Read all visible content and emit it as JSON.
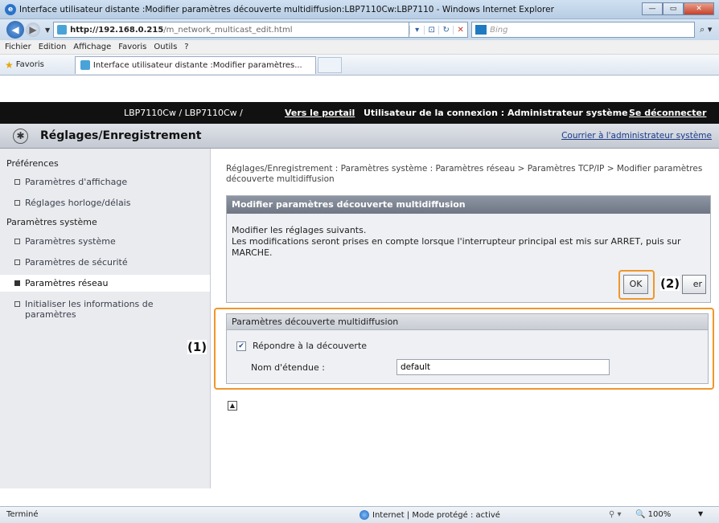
{
  "window": {
    "title": "Interface utilisateur distante :Modifier paramètres découverte multidiffusion:LBP7110Cw:LBP7110 - Windows Internet Explorer",
    "minimize": "—",
    "maximize": "▭",
    "close": "✕"
  },
  "address": {
    "url_host": "http://192.168.0.215",
    "url_path": "/m_network_multicast_edit.html",
    "search_placeholder": "Bing"
  },
  "menu": [
    "Fichier",
    "Edition",
    "Affichage",
    "Favoris",
    "Outils",
    "?"
  ],
  "favorites": {
    "label": "Favoris",
    "tab_title": "Interface utilisateur distante :Modifier paramètres..."
  },
  "topbar": {
    "model": "LBP7110Cw / LBP7110Cw /",
    "portal_link": "Vers le portail",
    "user_label": "Utilisateur de la connexion : Administrateur système",
    "logout": "Se déconnecter"
  },
  "category": {
    "title": "Réglages/Enregistrement",
    "mail_link": "Courrier à l'administrateur système"
  },
  "sidebar": {
    "section1": "Préférences",
    "items1": [
      "Paramètres d'affichage",
      "Réglages horloge/délais"
    ],
    "section2": "Paramètres système",
    "items2": [
      "Paramètres système",
      "Paramètres de sécurité",
      "Paramètres réseau",
      "Initialiser les informations de paramètres"
    ]
  },
  "breadcrumb": "Réglages/Enregistrement : Paramètres système : Paramètres réseau > Paramètres TCP/IP > Modifier paramètres découverte multidiffusion",
  "panel": {
    "title": "Modifier paramètres découverte multidiffusion",
    "line1": "Modifier les réglages suivants.",
    "line2": "Les modifications seront prises en compte lorsque l'interrupteur principal est mis sur ARRET, puis sur MARCHE.",
    "ok": "OK",
    "cancel_partial": "er"
  },
  "settings": {
    "title": "Paramètres découverte multidiffusion",
    "respond_label": "Répondre à la découverte",
    "respond_checked": true,
    "scope_label": "Nom d'étendue :",
    "scope_value": "default"
  },
  "annotations": {
    "one": "(1)",
    "two": "(2)"
  },
  "status": {
    "text": "Terminé",
    "zone": "Internet | Mode protégé : activé",
    "zoom": "100%"
  }
}
